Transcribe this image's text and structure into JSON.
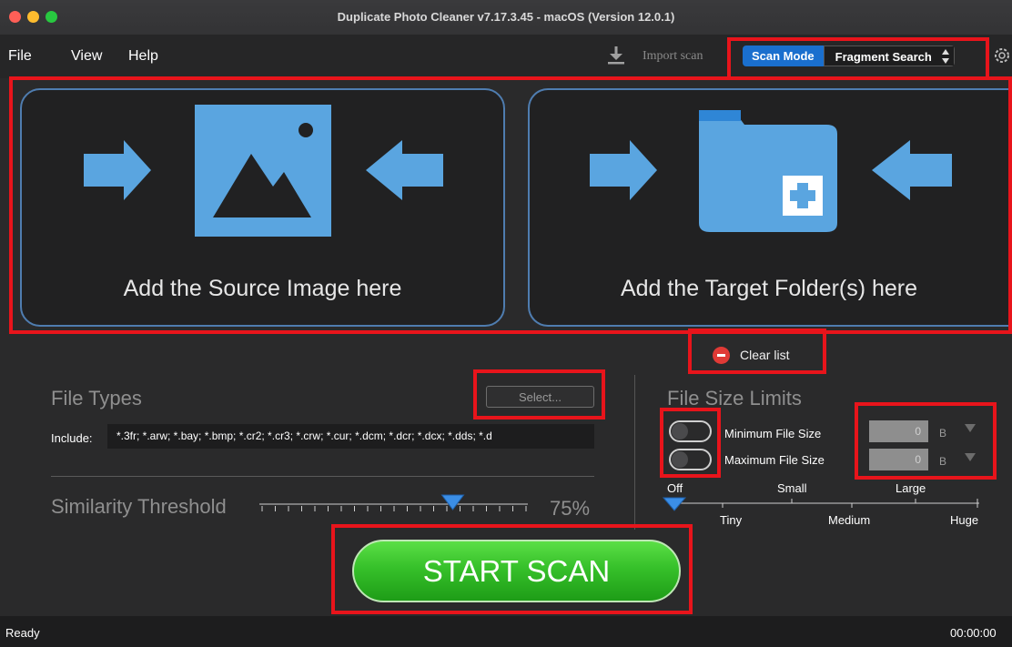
{
  "window": {
    "title": "Duplicate Photo Cleaner v7.17.3.45 - macOS (Version 12.0.1)"
  },
  "menu": {
    "items": [
      "File",
      "View",
      "Help"
    ]
  },
  "toolbar": {
    "import_label": "Import scan",
    "scan_mode_label": "Scan Mode",
    "scan_mode_value": "Fragment Search",
    "import_icon": "download-icon",
    "settings_icon": "gear-icon"
  },
  "drop_panels": {
    "source_text": "Add the Source Image here",
    "target_text": "Add the Target Folder(s) here",
    "source_icon": "image-icon",
    "target_icon": "folder-add-icon"
  },
  "clear_list": {
    "label": "Clear list",
    "icon": "minus-circle-icon"
  },
  "file_types": {
    "heading": "File Types",
    "select_label": "Select...",
    "include_label": "Include:",
    "include_value": "*.3fr; *.arw; *.bay; *.bmp; *.cr2; *.cr3; *.crw; *.cur; *.dcm; *.dcr; *.dcx; *.dds; *.d"
  },
  "similarity": {
    "label": "Similarity Threshold",
    "value": "75%",
    "level_fraction": 0.75
  },
  "file_size": {
    "heading": "File Size Limits",
    "min_label": "Minimum File Size",
    "max_label": "Maximum File Size",
    "min_value": "0",
    "max_value": "0",
    "unit": "B",
    "min_enabled": false,
    "max_enabled": false,
    "scale_labels_top": [
      "Off",
      "Small",
      "Large"
    ],
    "scale_labels_bottom": [
      "Tiny",
      "Medium",
      "Huge"
    ],
    "scale_level": "Off"
  },
  "start_scan": {
    "label": "START SCAN"
  },
  "status": {
    "text": "Ready",
    "time": "00:00:00"
  },
  "colors": {
    "accent_blue": "#1a6fce",
    "panel_border": "#4f7db0",
    "art_blue": "#5aa5e0",
    "start_green": "#36c02a",
    "highlight_red": "#e8141b",
    "clear_red": "#e03a36"
  }
}
